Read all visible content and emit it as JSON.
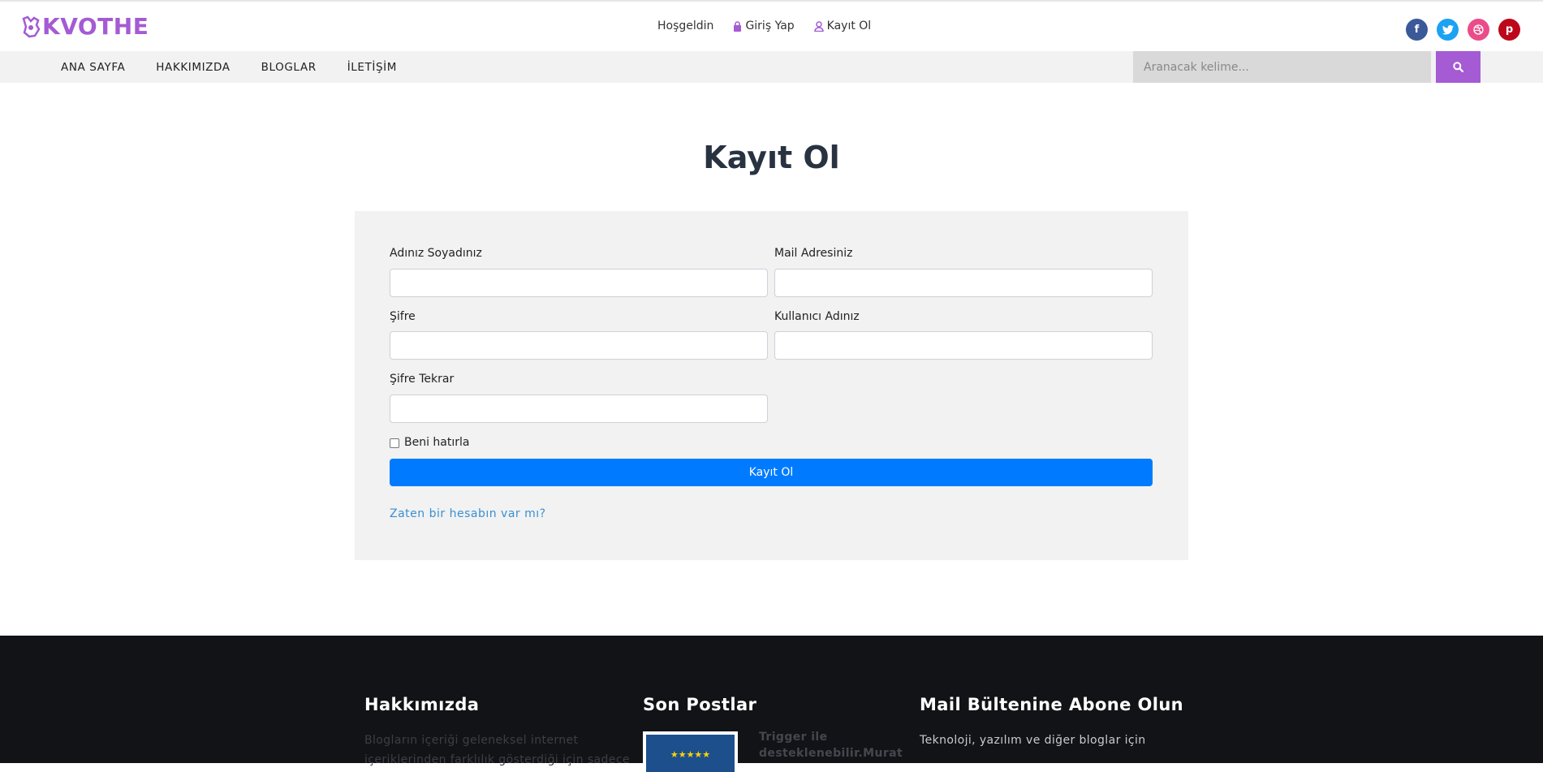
{
  "brand": {
    "name": "KVOTHE",
    "color": "#a45bd3"
  },
  "top_links": {
    "welcome": "Hoşgeldin",
    "login": "Giriş Yap",
    "register": "Kayıt Ol"
  },
  "social": [
    {
      "name": "facebook-icon",
      "glyph": "f",
      "color": "#3b5998"
    },
    {
      "name": "twitter-icon",
      "glyph": "t",
      "color": "#1da1f2"
    },
    {
      "name": "dribbble-icon",
      "glyph": "◎",
      "color": "#ea4c89"
    },
    {
      "name": "pinterest-icon",
      "glyph": "p",
      "color": "#bd081c"
    }
  ],
  "nav": {
    "items": [
      "ANA SAYFA",
      "HAKKIMIZDA",
      "BLOGLAR",
      "İLETİŞİM"
    ],
    "search_placeholder": "Aranacak kelime..."
  },
  "page": {
    "title": "Kayıt Ol"
  },
  "form": {
    "name_label": "Adınız Soyadınız",
    "mail_label": "Mail Adresiniz",
    "password_label": "Şifre",
    "username_label": "Kullanıcı Adınız",
    "password_repeat_label": "Şifre Tekrar",
    "remember_label": "Beni hatırla",
    "submit_label": "Kayıt Ol",
    "login_link": "Zaten bir hesabın var mı?"
  },
  "footer": {
    "about_title": "Hakkımızda",
    "about_text": "Blogların içeriği geleneksel internet",
    "about_text_2": "içeriklerinden farklılık gösterdiği için sadece",
    "posts_title": "Son Postlar",
    "post_title_1": "Trigger ile",
    "post_title_2": "desteklenebilir.Murat",
    "newsletter_title": "Mail Bültenine Abone Olun",
    "newsletter_text": "Teknoloji, yazılım ve diğer bloglar için"
  },
  "colors": {
    "accent": "#a45bd3",
    "primary": "#007bff",
    "footer_bg": "#121316"
  }
}
